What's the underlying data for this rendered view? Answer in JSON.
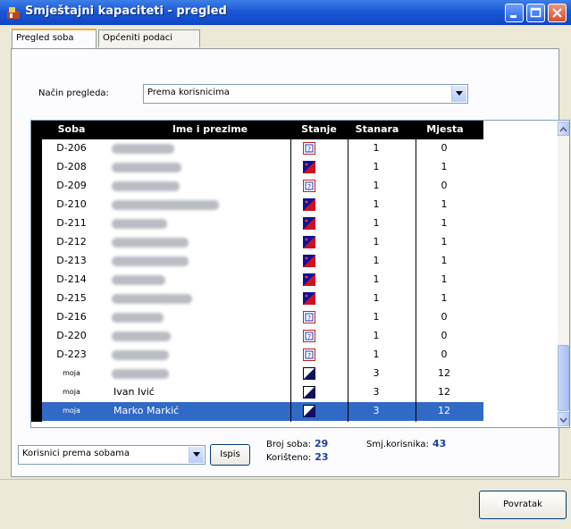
{
  "window": {
    "title": "Smještajni kapaciteti - pregled"
  },
  "tabs": [
    {
      "label": "Pregled soba",
      "active": true
    },
    {
      "label": "Općeniti podaci",
      "active": false
    }
  ],
  "view_mode": {
    "label": "Način pregleda:",
    "value": "Prema korisnicima"
  },
  "table": {
    "columns": [
      "Soba",
      "Ime i prezime",
      "Stanje",
      "Stanara",
      "Mjesta"
    ],
    "rows": [
      {
        "soba": "D-206",
        "ime": "",
        "stanje": "empty",
        "stanara": "1",
        "mjesta": "0"
      },
      {
        "soba": "D-208",
        "ime": "",
        "stanje": "occupied",
        "stanara": "1",
        "mjesta": "1"
      },
      {
        "soba": "D-209",
        "ime": "",
        "stanje": "empty",
        "stanara": "1",
        "mjesta": "0"
      },
      {
        "soba": "D-210",
        "ime": "",
        "stanje": "occupied",
        "stanara": "1",
        "mjesta": "1"
      },
      {
        "soba": "D-211",
        "ime": "",
        "stanje": "occupied",
        "stanara": "1",
        "mjesta": "1"
      },
      {
        "soba": "D-212",
        "ime": "",
        "stanje": "occupied",
        "stanara": "1",
        "mjesta": "1"
      },
      {
        "soba": "D-213",
        "ime": "",
        "stanje": "occupied",
        "stanara": "1",
        "mjesta": "1"
      },
      {
        "soba": "D-214",
        "ime": "",
        "stanje": "occupied",
        "stanara": "1",
        "mjesta": "1"
      },
      {
        "soba": "D-215",
        "ime": "",
        "stanje": "occupied",
        "stanara": "1",
        "mjesta": "1"
      },
      {
        "soba": "D-216",
        "ime": "",
        "stanje": "empty",
        "stanara": "1",
        "mjesta": "0"
      },
      {
        "soba": "D-220",
        "ime": "",
        "stanje": "empty",
        "stanara": "1",
        "mjesta": "0"
      },
      {
        "soba": "D-223",
        "ime": "",
        "stanje": "empty",
        "stanara": "1",
        "mjesta": "0"
      },
      {
        "soba": "moja",
        "ime": "",
        "stanje": "partial",
        "stanara": "3",
        "mjesta": "12"
      },
      {
        "soba": "moja",
        "ime": "Ivan Ivić",
        "stanje": "partial",
        "stanara": "3",
        "mjesta": "12"
      },
      {
        "soba": "moja",
        "ime": "Marko Markić",
        "stanje": "partial",
        "stanara": "3",
        "mjesta": "12",
        "selected": true
      }
    ]
  },
  "footer": {
    "filter_value": "Korisnici prema sobama",
    "print_button": "Ispis",
    "broj_soba_label": "Broj soba:",
    "broj_soba_value": "29",
    "korisnika_label": "Smj.korisnika:",
    "korisnika_value": "43",
    "koristeno_label": "Korišteno:",
    "koristeno_value": "23"
  },
  "buttons": {
    "back": "Povratak"
  },
  "colors": {
    "titlebar": "#1a58d6",
    "header": "#000000",
    "selection": "#3169c6",
    "stat_value": "#1a3da0"
  }
}
